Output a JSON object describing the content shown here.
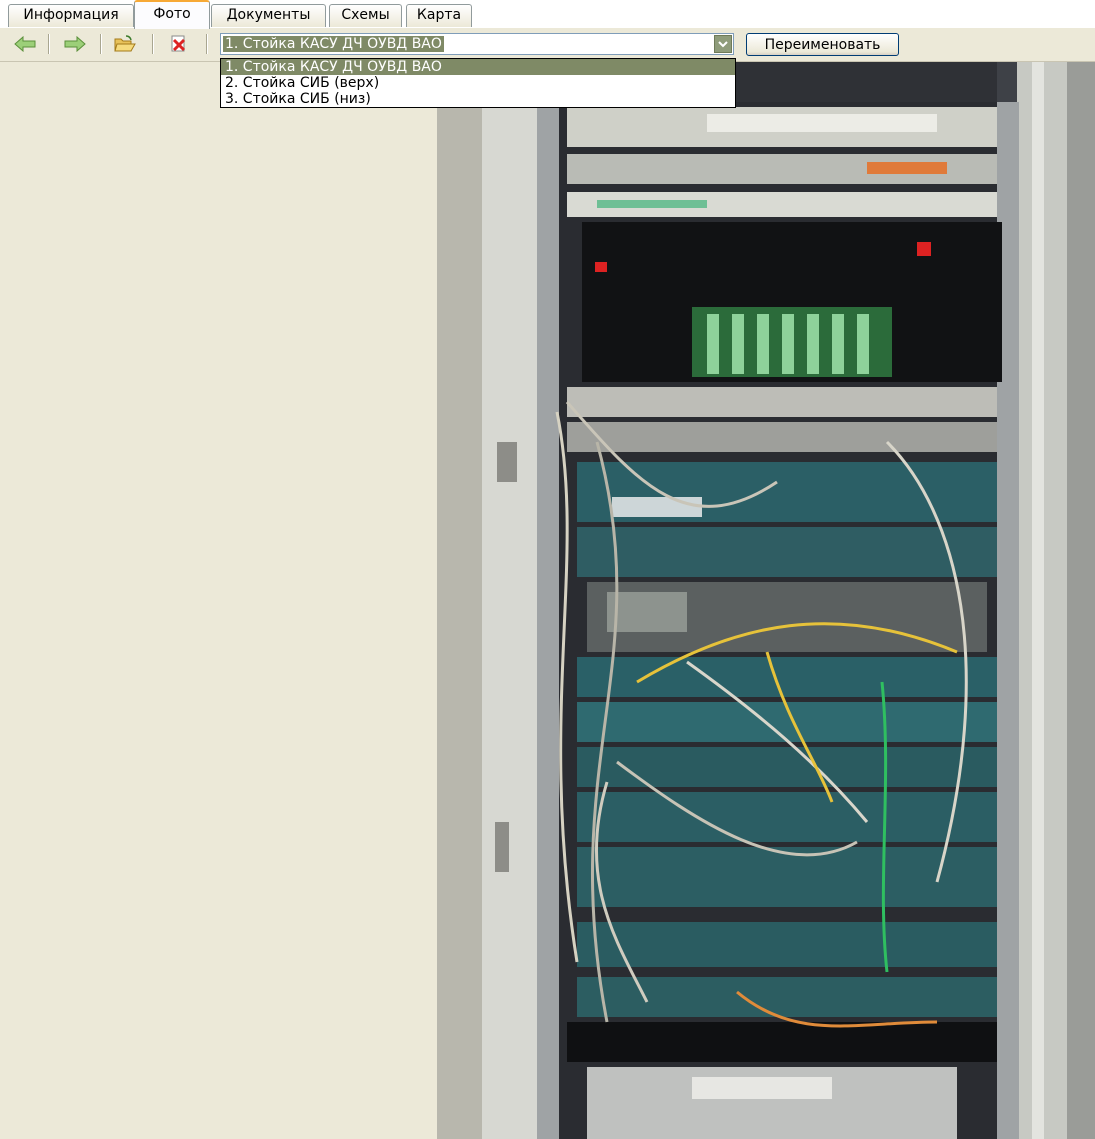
{
  "tabs": [
    {
      "label": "Информация"
    },
    {
      "label": "Фото"
    },
    {
      "label": "Документы"
    },
    {
      "label": "Схемы"
    },
    {
      "label": "Карта"
    }
  ],
  "toolbar": {
    "icons": [
      "arrow-left-icon",
      "arrow-right-icon",
      "folder-open-icon",
      "delete-icon"
    ],
    "combo": {
      "value": "1. Стойка КАСУ ДЧ ОУВД ВАО"
    },
    "rename_label": "Переименовать"
  },
  "dropdown": {
    "options": [
      {
        "label": "1. Стойка КАСУ ДЧ ОУВД ВАО",
        "selected": true
      },
      {
        "label": "2. Стойка СИБ (верх)"
      },
      {
        "label": "3. Стойка СИБ (низ)"
      }
    ]
  },
  "photo": {
    "subject": "server-rack-photo"
  },
  "colors": {
    "panel_bg": "#ece9d8",
    "selection": "#7f8a66",
    "tab_active_accent": "#f7a935"
  }
}
